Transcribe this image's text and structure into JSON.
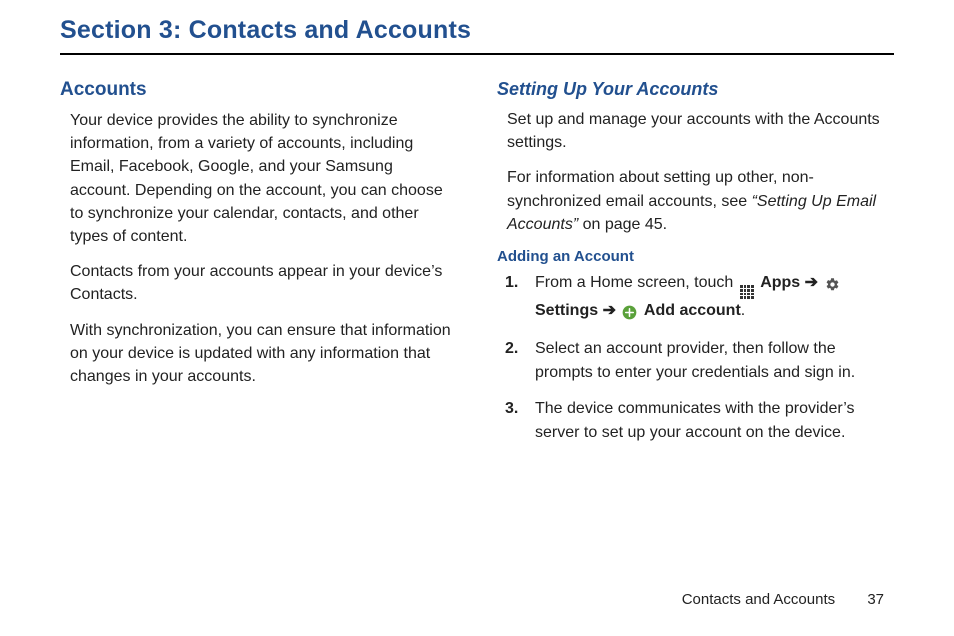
{
  "section_title": "Section 3: Contacts and Accounts",
  "left": {
    "heading": "Accounts",
    "p1": "Your device provides the ability to synchronize information, from a variety of accounts, including Email, Facebook, Google, and your Samsung account. Depending on the account, you can choose to synchronize your calendar, contacts, and other types of content.",
    "p2": "Contacts from your accounts appear in your device’s Contacts.",
    "p3": "With synchronization, you can ensure that information on your device is updated with any information that changes in your accounts."
  },
  "right": {
    "heading": "Setting Up Your Accounts",
    "p1": "Set up and manage your accounts with the Accounts settings.",
    "p2_pre": "For information about setting up other, non-synchronized email accounts, see ",
    "p2_link": "“Setting Up Email Accounts”",
    "p2_post": " on page 45.",
    "sub_heading": "Adding an Account",
    "step1_pre": "From a Home screen, touch ",
    "step1_apps": "Apps",
    "step1_arrow": " ➔ ",
    "step1_settings": "Settings",
    "step1_arrow2": " ➔ ",
    "step1_add": "Add account",
    "step1_end": ".",
    "step2": "Select an account provider, then follow the prompts to enter your credentials and sign in.",
    "step3": "The device communicates with the provider’s server to set up your account on the device."
  },
  "footer": {
    "label": "Contacts and Accounts",
    "page": "37"
  }
}
